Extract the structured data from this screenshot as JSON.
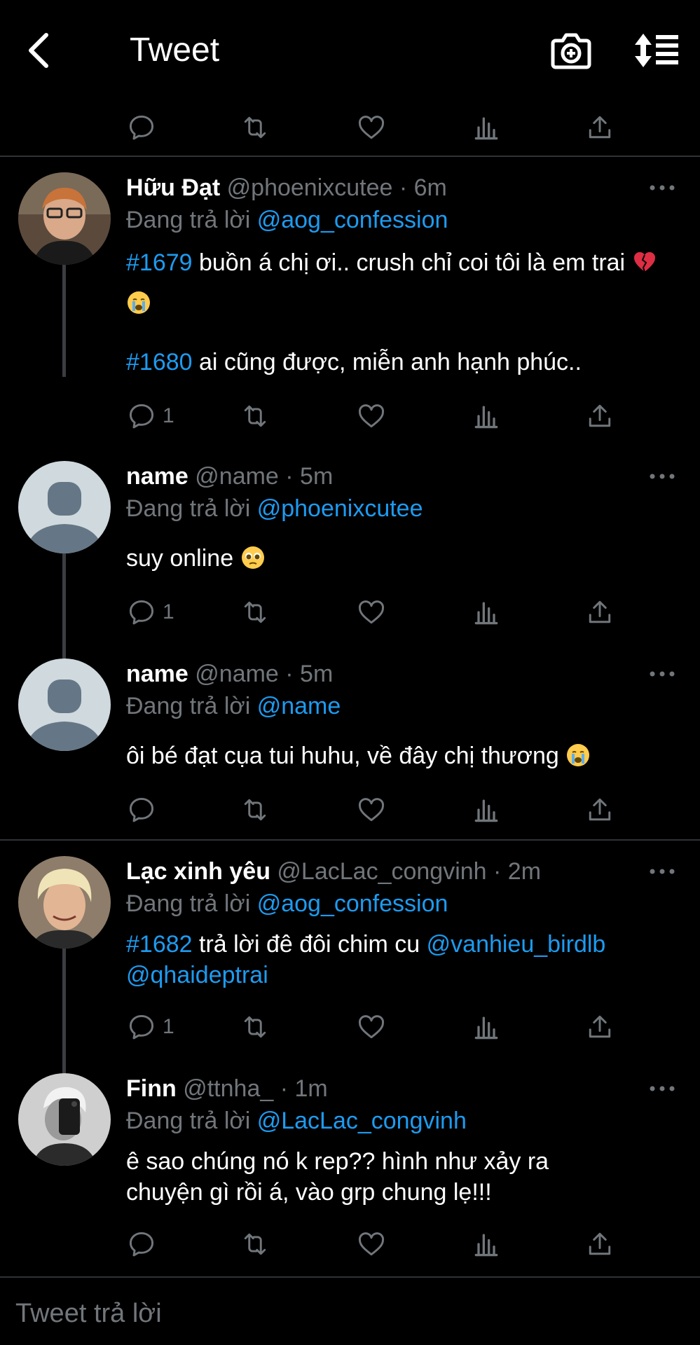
{
  "header": {
    "title": "Tweet"
  },
  "tweets": [
    {
      "name": "Hữu Đạt",
      "meta": "@phoenixcutee · 6m",
      "replying_prefix": "Đang trả lời ",
      "replying_to": "@aog_confession",
      "p1_tag": "#1679",
      "p1_text": " buồn á chị ơi.. crush chỉ coi tôi là em trai ",
      "p2_tag": "#1680",
      "p2_text": " ai cũng được, miễn anh hạnh phúc..",
      "reply_count": "1"
    },
    {
      "name": "name",
      "meta": "@name · 5m",
      "replying_prefix": "Đang trả lời ",
      "replying_to": "@phoenixcutee",
      "text": "suy online ",
      "reply_count": "1"
    },
    {
      "name": "name",
      "meta": "@name · 5m",
      "replying_prefix": "Đang trả lời ",
      "replying_to": "@name",
      "text": "ôi bé đạt cụa tui huhu, về đây chị thương ",
      "reply_count": ""
    },
    {
      "name": "Lạc xinh yêu",
      "meta": "@LacLac_congvinh · 2m",
      "replying_prefix": "Đang trả lời ",
      "replying_to": "@aog_confession",
      "tag": "#1682",
      "text": " trả lời đê đôi chim cu ",
      "mention1": "@vanhieu_birdlb",
      "mention2": "@qhaideptrai",
      "reply_count": "1"
    },
    {
      "name": "Finn",
      "meta": "@ttnha_ · 1m",
      "replying_prefix": "Đang trả lời ",
      "replying_to": "@LacLac_congvinh",
      "text": "ê sao chúng nó k rep?? hình như xảy ra chuyện gì rồi á, vào grp chung lẹ!!!",
      "reply_count": ""
    }
  ],
  "compose": {
    "placeholder": "Tweet trả lời"
  },
  "colors": {
    "background": "#000000",
    "link": "#1d9bf0",
    "secondary": "#71767b",
    "divider": "#2f3336"
  }
}
